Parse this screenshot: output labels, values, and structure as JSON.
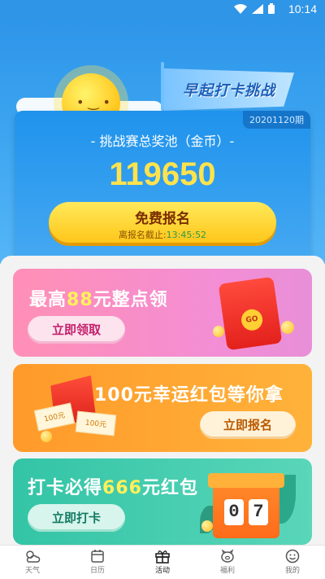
{
  "status_bar": {
    "time": "10:14"
  },
  "hero": {
    "flag_text": "早起打卡挑战",
    "period": "20201120期",
    "pool_title": "- 挑战赛总奖池（金币）-",
    "pool_amount": "119650",
    "signup_button": {
      "label": "免费报名",
      "deadline_label": "离报名截止:",
      "deadline_time": "13:45:52"
    }
  },
  "cards": [
    {
      "title_prefix": "最高",
      "title_highlight": "88",
      "title_suffix": "元整点领",
      "button": "立即领取",
      "decoration": "GO"
    },
    {
      "title": "100元幸运红包等你拿",
      "button": "立即报名",
      "decoration_paper_1": "100元",
      "decoration_paper_2": "100元"
    },
    {
      "title_prefix": "打卡必得",
      "title_highlight": "666",
      "title_suffix": "元红包",
      "button": "立即打卡",
      "digits": [
        "0",
        "7"
      ]
    }
  ],
  "tabs": [
    {
      "label": "天气",
      "icon": "weather-icon"
    },
    {
      "label": "日历",
      "icon": "calendar-icon"
    },
    {
      "label": "活动",
      "icon": "gift-icon",
      "active": true
    },
    {
      "label": "福利",
      "icon": "pig-icon"
    },
    {
      "label": "我的",
      "icon": "smile-icon"
    }
  ]
}
